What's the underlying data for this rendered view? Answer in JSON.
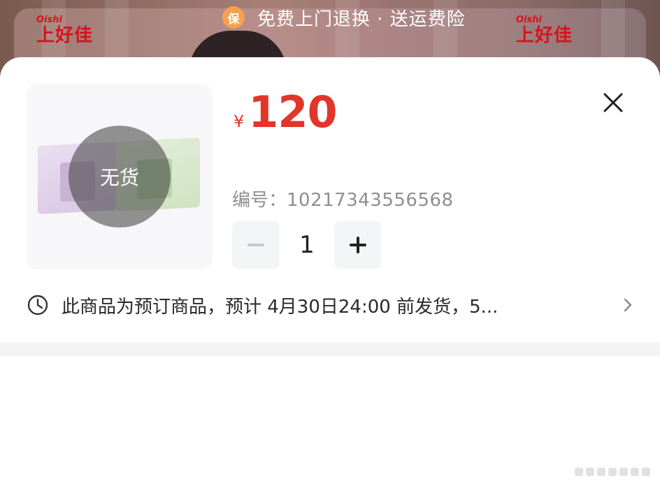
{
  "banner": {
    "promo_badge": "保",
    "promo_text": "免费上门退换 · 送运费险",
    "brand_small": "Oishi",
    "brand_big": "上好佳"
  },
  "product": {
    "stock_overlay": "无货",
    "currency_symbol": "¥",
    "price": "120",
    "code_label": "编号：",
    "code_value": "10217343556568"
  },
  "quantity": {
    "value": "1",
    "minus_symbol": "−",
    "plus_symbol": "+"
  },
  "notice": {
    "text": "此商品为预订商品，预计 4月30日24:00 前发货，5..."
  },
  "icons": {
    "close": "close-icon",
    "clock": "clock-icon",
    "chevron": "chevron-right-icon"
  },
  "colors": {
    "price": "#e2362a",
    "promo_badge": "#f5a14e",
    "brand": "#d8121e"
  }
}
